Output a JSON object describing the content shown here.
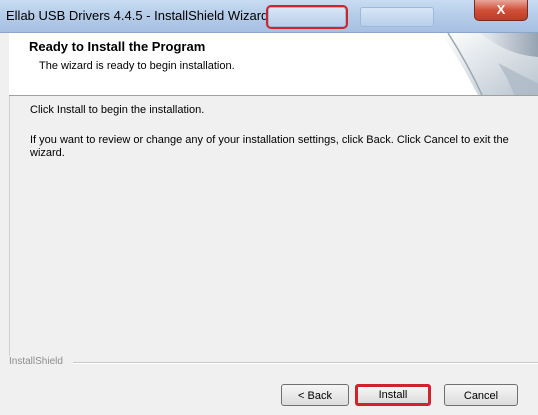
{
  "window": {
    "title": "Ellab USB Drivers 4.4.5 - InstallShield Wizard",
    "close_label": "X"
  },
  "header": {
    "title": "Ready to Install the Program",
    "subtitle": "The wizard is ready to begin installation."
  },
  "body": {
    "line1": "Click Install to begin the installation.",
    "line2": "If you want to review or change any of your installation settings, click Back. Click Cancel to exit the wizard."
  },
  "footer": {
    "brand": "InstallShield",
    "back_label": "< Back",
    "install_label": "Install",
    "cancel_label": "Cancel"
  },
  "colors": {
    "highlight": "#d2232a",
    "titlebar": "#b6cde9"
  }
}
